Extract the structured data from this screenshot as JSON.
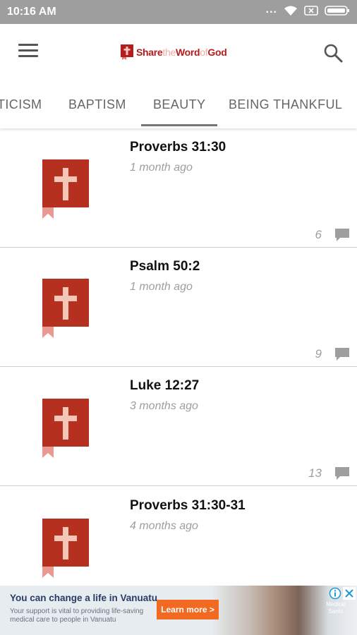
{
  "status_bar": {
    "time": "10:16 AM",
    "icons": [
      "more-dots-icon",
      "wifi-icon",
      "sim-icon",
      "battery-icon"
    ],
    "dots": "..."
  },
  "app_bar": {
    "logo": {
      "share": "Share",
      "the": "the",
      "word": "Word",
      "of": "of",
      "god": "God"
    },
    "icons": [
      "menu-icon",
      "search-icon"
    ]
  },
  "tabs": [
    {
      "label": "TICISM",
      "selected": false
    },
    {
      "label": "BAPTISM",
      "selected": false
    },
    {
      "label": "BEAUTY",
      "selected": true
    },
    {
      "label": "BEING THANKFUL",
      "selected": false
    }
  ],
  "posts": [
    {
      "title": "Proverbs 31:30",
      "time": "1 month ago",
      "comments": "6"
    },
    {
      "title": "Psalm 50:2",
      "time": "1 month ago",
      "comments": "9"
    },
    {
      "title": "Luke 12:27",
      "time": "3 months ago",
      "comments": "13"
    },
    {
      "title": "Proverbs 31:30-31",
      "time": "4 months ago",
      "comments": ""
    }
  ],
  "ad": {
    "headline": "You can change a life in Vanuatu",
    "body": "Your support is vital to providing life-saving medical care to people in Vanuatu",
    "cta": "Learn more >",
    "sponsor": "Medical Santo"
  },
  "colors": {
    "brand_red": "#b71c1c",
    "brand_pink": "#f4a9a1",
    "status_bar_bg": "#9e9e9e",
    "thumb_red": "#b5301f",
    "cta_orange": "#f26a21"
  }
}
